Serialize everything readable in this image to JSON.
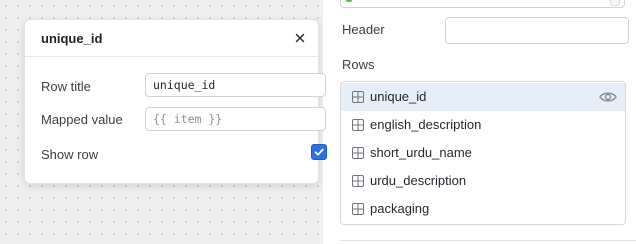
{
  "popover": {
    "title": "unique_id",
    "fields": {
      "row_title_label": "Row title",
      "row_title_value": "unique_id",
      "mapped_value_label": "Mapped value",
      "mapped_value_placeholder": "{{ item }}",
      "show_row_label": "Show row",
      "show_row_checked": true
    }
  },
  "panel": {
    "header_label": "Header",
    "header_value": "",
    "rows_label": "Rows",
    "rows": [
      {
        "label": "unique_id",
        "selected": true,
        "icon": "grid-icon",
        "action_icon": "eye-icon"
      },
      {
        "label": "english_description",
        "selected": false,
        "icon": "grid-icon"
      },
      {
        "label": "short_urdu_name",
        "selected": false,
        "icon": "grid-icon"
      },
      {
        "label": "urdu_description",
        "selected": false,
        "icon": "grid-icon"
      },
      {
        "label": "packaging",
        "selected": false,
        "icon": "grid-icon"
      }
    ]
  },
  "colors": {
    "accent": "#2f6fe4",
    "selected_row": "#e6eefa",
    "canvas": "#efefef"
  }
}
